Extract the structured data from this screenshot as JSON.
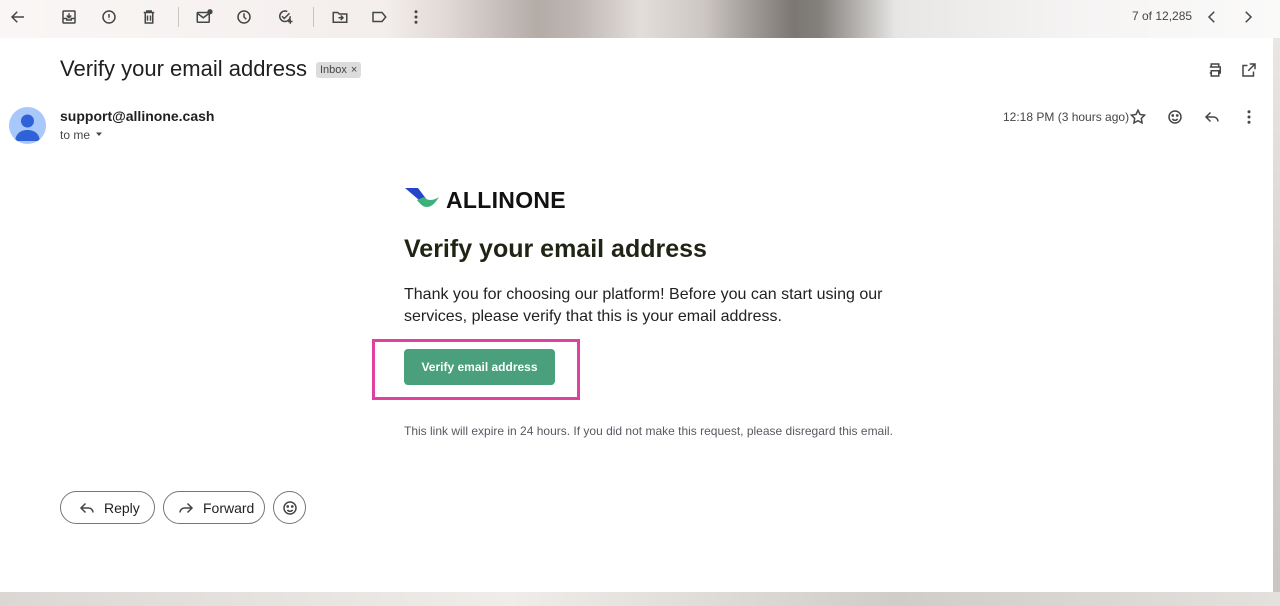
{
  "toolbar": {
    "icons": [
      "back-arrow-icon",
      "archive-icon",
      "report-spam-icon",
      "delete-icon",
      "mark-unread-icon",
      "snooze-icon",
      "add-task-icon",
      "move-to-icon",
      "label-icon",
      "more-vert-icon"
    ],
    "pager_text": "7 of 12,285"
  },
  "message": {
    "subject": "Verify your email address",
    "label_chip": "Inbox",
    "label_chip_close": "×",
    "sender": "support@allinone.cash",
    "recipient_text": "to me",
    "time": "12:18 PM (3 hours ago)"
  },
  "email_body": {
    "brand": "ALLINONE",
    "title": "Verify your email address",
    "paragraph": "Thank you for choosing our platform! Before you can start using our services, please verify that this is your email address.",
    "button_label": "Verify email address",
    "expire_note": "This link will expire in 24 hours. If you did not make this request, please disregard this email.",
    "button_color": "#4a9f7d",
    "highlight_color": "#e0409e"
  },
  "actions": {
    "reply_label": "Reply",
    "forward_label": "Forward"
  }
}
